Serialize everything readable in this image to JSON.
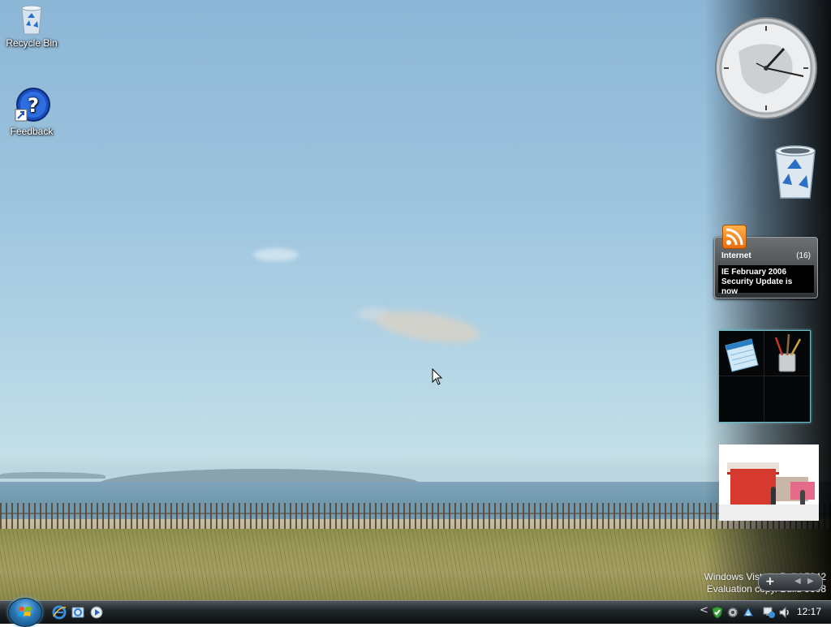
{
  "desktop": {
    "icons": [
      {
        "label": "Recycle Bin",
        "icon": "recycle-bin-icon"
      },
      {
        "label": "Feedback",
        "icon": "help-shortcut-icon"
      }
    ]
  },
  "sidebar": {
    "feed_gadget": {
      "title": "Internet",
      "count": "(16)",
      "headline_line1": "IE February 2006",
      "headline_line2": "Security Update is now"
    },
    "watermark_line1": "Windows Vista™ Build 5342",
    "watermark_line2": "Evaluation copy. Build 5308"
  },
  "taskbar": {
    "clock": "12:17",
    "quick_launch": [
      "internet-explorer-icon",
      "show-desktop-icon",
      "media-player-icon"
    ],
    "tray_icons": [
      "tray-expand-icon",
      "security-shield-icon",
      "update-gear-icon",
      "network-tray-icon",
      "sync-tray-icon",
      "network-monitor-icon",
      "speaker-icon"
    ]
  },
  "colors": {
    "taskbar": "#1d2326",
    "sidebar": "#0a0f14",
    "gadget_accent": "#6fb7c0"
  }
}
